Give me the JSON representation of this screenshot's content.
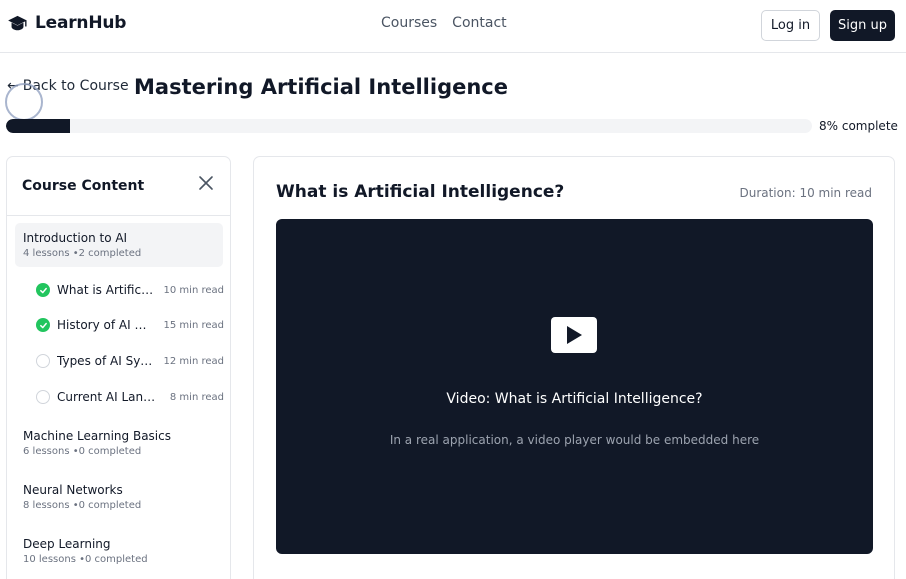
{
  "brand": {
    "name": "LearnHub",
    "icon": "graduation-cap-icon"
  },
  "nav": {
    "courses": "Courses",
    "contact": "Contact"
  },
  "auth": {
    "login": "Log in",
    "signup": "Sign up"
  },
  "course": {
    "back_label": "Back to Course",
    "title": "Mastering Artificial Intelligence",
    "progress_percent": 8,
    "progress_label": "8% complete"
  },
  "sidebar": {
    "title": "Course Content",
    "modules": [
      {
        "title": "Introduction to AI",
        "meta": "4 lessons •2 completed",
        "lessons": [
          {
            "name": "What is Artificial Intelligence?",
            "duration": "10 min read",
            "completed": true
          },
          {
            "name": "History of AI Development",
            "duration": "15 min read",
            "completed": true
          },
          {
            "name": "Types of AI Systems",
            "duration": "12 min read",
            "completed": false
          },
          {
            "name": "Current AI Landscape",
            "duration": "8 min read",
            "completed": false
          }
        ]
      },
      {
        "title": "Machine Learning Basics",
        "meta": "6 lessons •0 completed"
      },
      {
        "title": "Neural Networks",
        "meta": "8 lessons •0 completed"
      },
      {
        "title": "Deep Learning",
        "meta": "10 lessons •0 completed"
      }
    ]
  },
  "lesson": {
    "title": "What is Artificial Intelligence?",
    "duration": "Duration: 10 min read",
    "video_title": "Video: What is Artificial Intelligence?",
    "video_note": "In a real application, a video player would be embedded here"
  },
  "colors": {
    "primary": "#111827",
    "success": "#22c55e",
    "muted": "#6b7280",
    "border": "#e5e7eb"
  }
}
